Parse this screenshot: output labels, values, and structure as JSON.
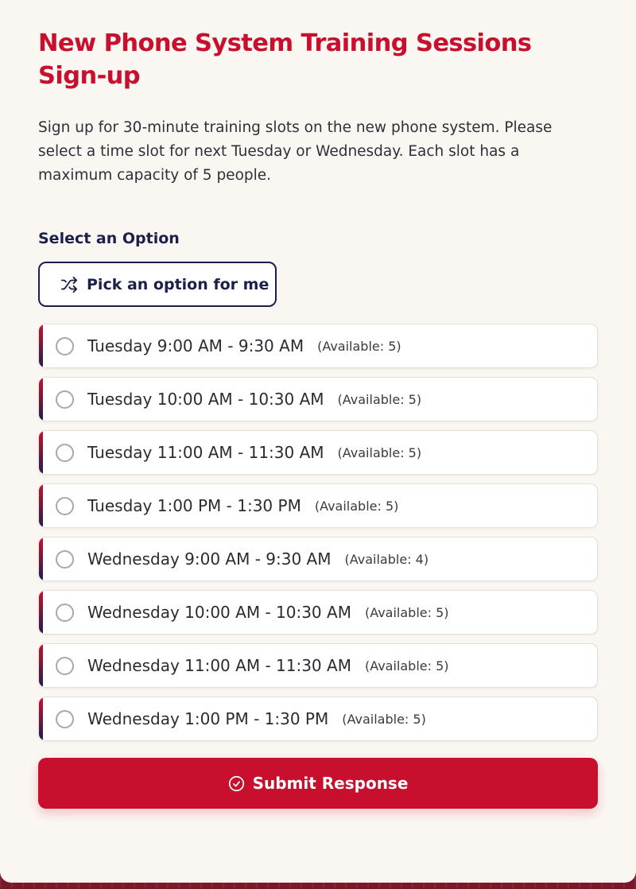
{
  "form": {
    "title": "New Phone System Training Sessions Sign-up",
    "description": "Sign up for 30-minute training slots on the new phone system. Please select a time slot for next Tuesday or Wednesday. Each slot has a maximum capacity of 5 people.",
    "field_label": "Select an Option",
    "pick_button_label": "Pick an option for me",
    "submit_label": "Submit Response",
    "options": [
      {
        "label": "Tuesday 9:00 AM - 9:30 AM",
        "availability": "(Available: 5)"
      },
      {
        "label": "Tuesday 10:00 AM - 10:30 AM",
        "availability": "(Available: 5)"
      },
      {
        "label": "Tuesday 11:00 AM - 11:30 AM",
        "availability": "(Available: 5)"
      },
      {
        "label": "Tuesday 1:00 PM - 1:30 PM",
        "availability": "(Available: 5)"
      },
      {
        "label": "Wednesday 9:00 AM - 9:30 AM",
        "availability": "(Available: 4)"
      },
      {
        "label": "Wednesday 10:00 AM - 10:30 AM",
        "availability": "(Available: 5)"
      },
      {
        "label": "Wednesday 11:00 AM - 11:30 AM",
        "availability": "(Available: 5)"
      },
      {
        "label": "Wednesday 1:00 PM - 1:30 PM",
        "availability": "(Available: 5)"
      }
    ]
  },
  "icons": {
    "pick_button": "shuffle-icon",
    "submit_button": "check-circle-icon"
  },
  "colors": {
    "accent": "#c8102e",
    "navy": "#1c1f4a",
    "card_background": "#faf7f3",
    "page_background": "#7a1a28"
  }
}
